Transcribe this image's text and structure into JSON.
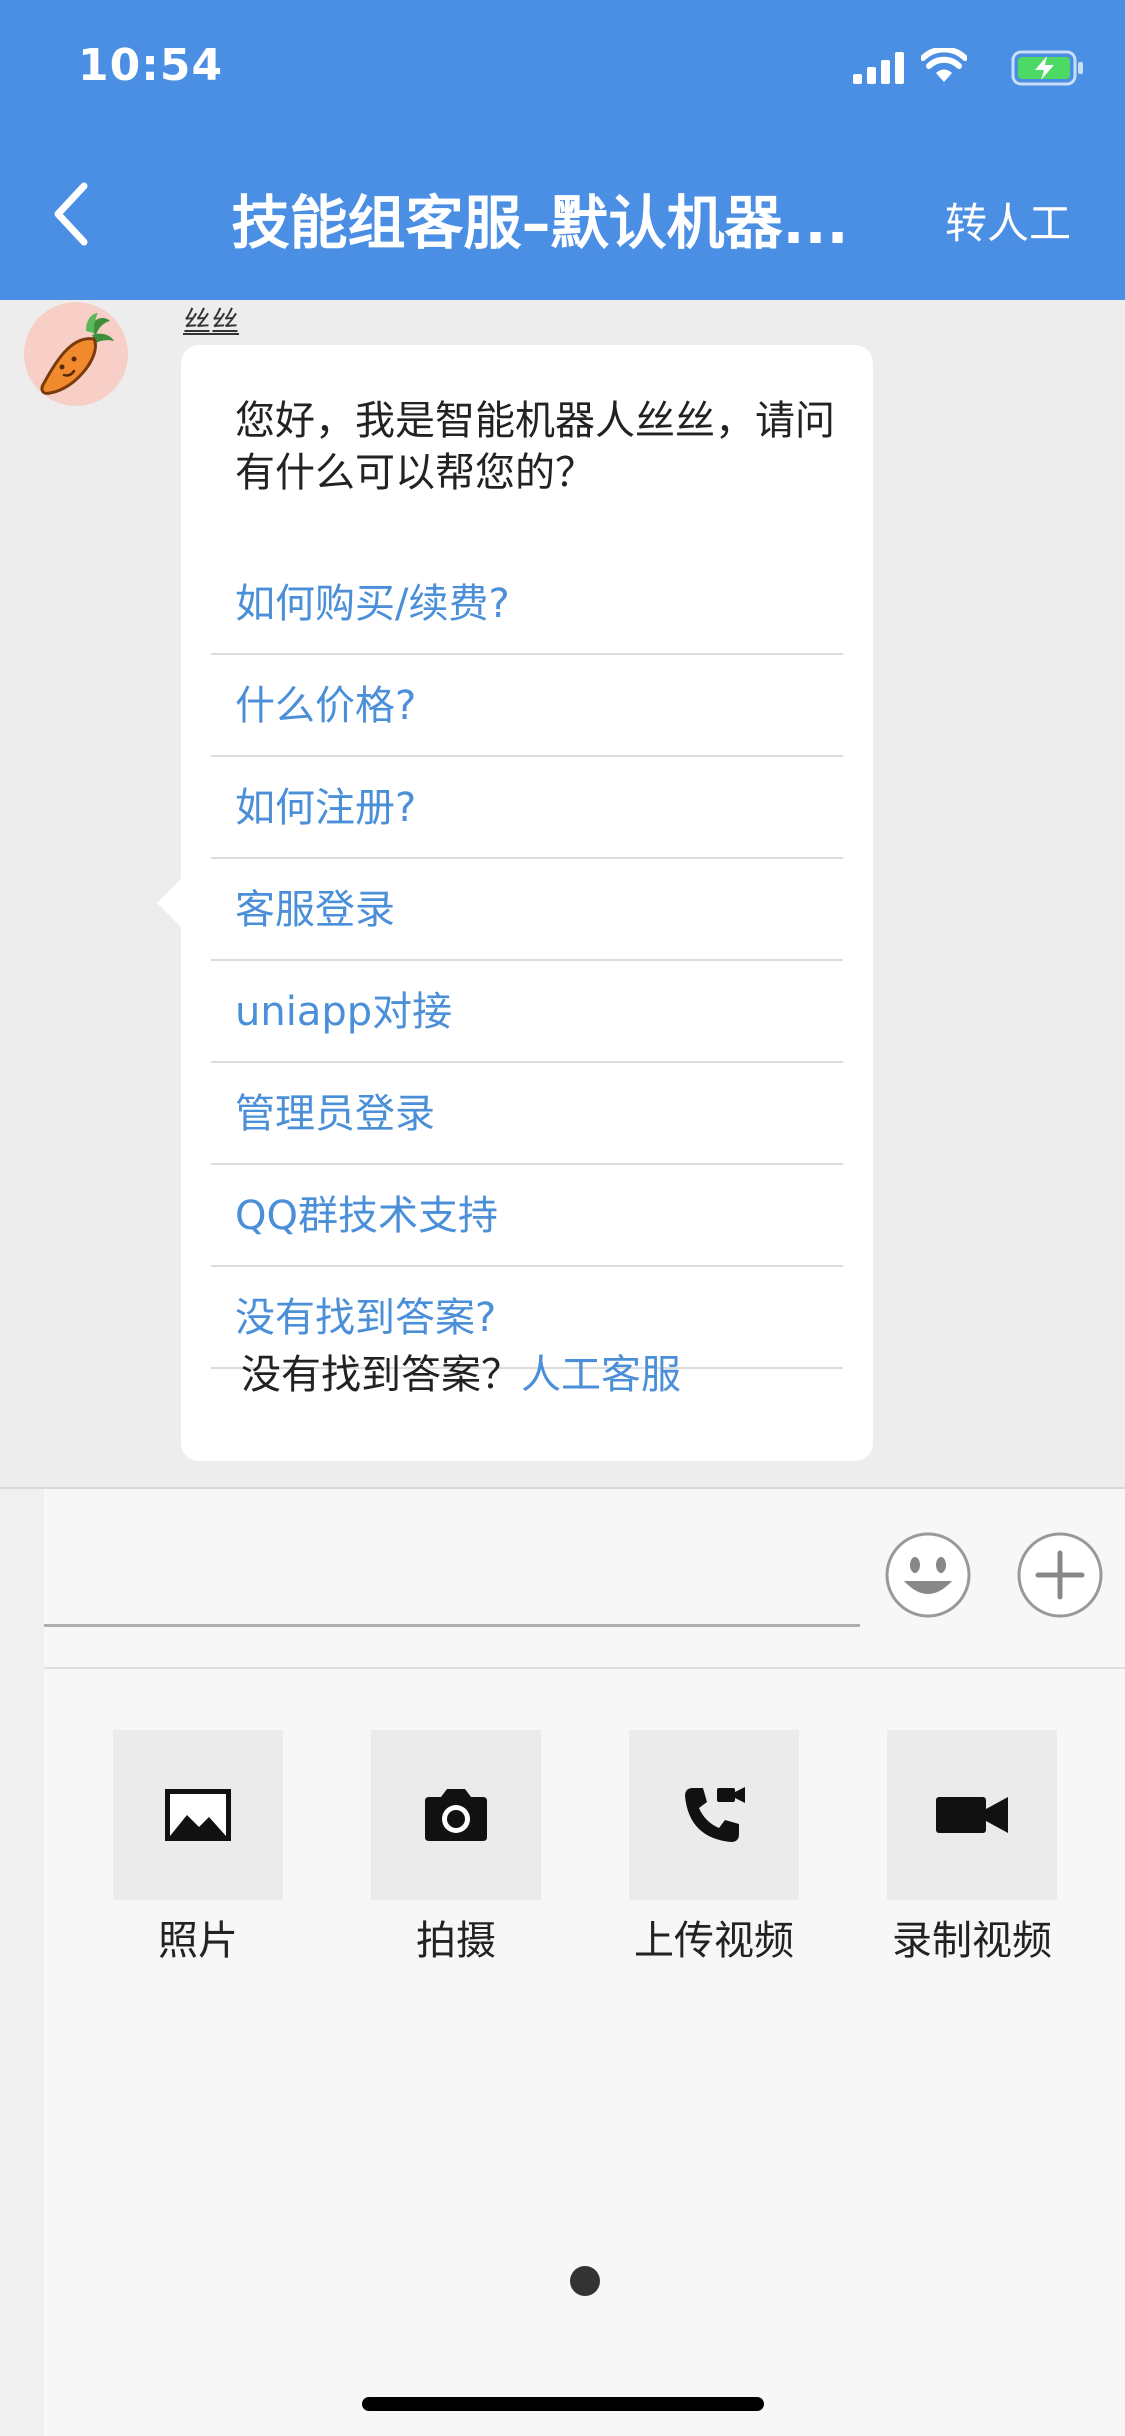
{
  "status_bar": {
    "time": "10:54"
  },
  "nav": {
    "title": "技能组客服–默认机器...",
    "right_action": "转人工"
  },
  "chat": {
    "sender": "丝丝",
    "greeting": "您好，我是智能机器人丝丝，请问有什么可以帮您的？",
    "links": [
      "如何购买/续费?",
      "什么价格?",
      "如何注册?",
      "客服登录",
      "uniapp对接",
      "管理员登录",
      "QQ群技术支持",
      "没有找到答案?"
    ],
    "footer_text": "没有找到答案？",
    "footer_link": "人工客服"
  },
  "input": {
    "placeholder": ""
  },
  "tools": [
    {
      "label": "照片",
      "icon": "image-icon"
    },
    {
      "label": "拍摄",
      "icon": "camera-icon"
    },
    {
      "label": "上传视频",
      "icon": "video-call-icon"
    },
    {
      "label": "录制视频",
      "icon": "videocam-icon"
    }
  ],
  "colors": {
    "header": "#4a8fe4",
    "link": "#4a8fd8",
    "avatar_bg": "#f8cfc7"
  }
}
